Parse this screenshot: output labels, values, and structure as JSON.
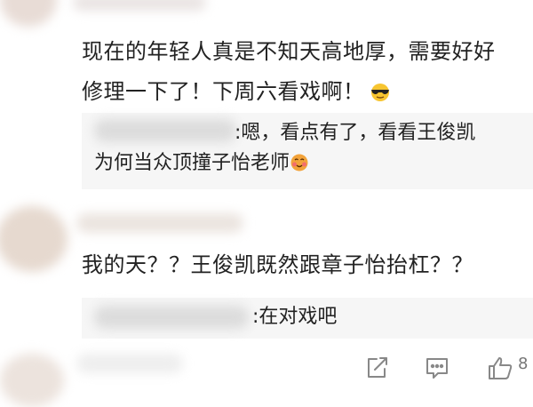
{
  "comments": [
    {
      "text_line1": "现在的年轻人真是不知天高地厚，需要好好",
      "text_line2": "修理一下了！下周六看戏啊！",
      "emoji": "sunglasses-emoji",
      "reply": {
        "name_sep": ":",
        "text_line1": "嗯，看点有了，看看王俊凯",
        "text_line2": "为何当众顶撞子怡老师",
        "emoji": "blush-emoji"
      }
    },
    {
      "text": "我的天？？王俊凯既然跟章子怡抬杠？？",
      "reply": {
        "name_sep": ":",
        "text": "在对戏吧"
      }
    }
  ],
  "actions": {
    "forward_icon": "forward-icon",
    "comment_icon": "comment-icon",
    "like_icon": "thumbs-up-icon",
    "like_count": "8"
  },
  "colors": {
    "background": "#ffffff",
    "reply_background": "#f6f6f6",
    "text": "#222222",
    "icon": "#888888"
  }
}
